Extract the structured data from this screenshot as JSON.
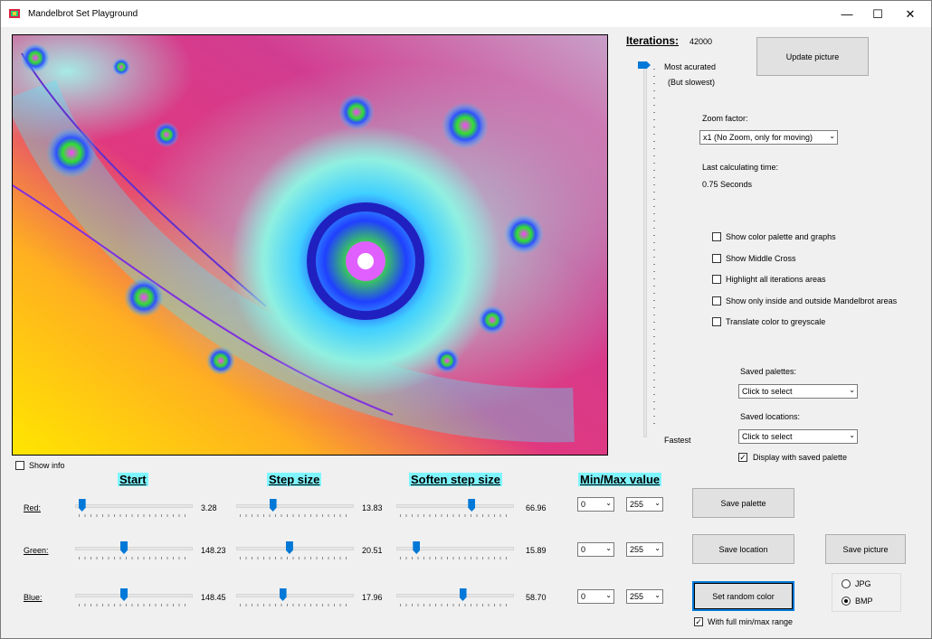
{
  "window": {
    "title": "Mandelbrot Set Playground",
    "minimize": "—",
    "maximize": "☐",
    "close": "✕"
  },
  "iterations": {
    "heading": "Iterations:",
    "value": "42000",
    "most": "Most acurated",
    "most_note": "(But slowest)",
    "fastest": "Fastest"
  },
  "update_button": "Update picture",
  "zoom": {
    "label": "Zoom factor:",
    "value": "x1 (No Zoom, only for moving)"
  },
  "calc_time": {
    "label": "Last calculating time:",
    "value": "0.75 Seconds"
  },
  "options": [
    {
      "label": "Show color palette and graphs",
      "checked": false
    },
    {
      "label": "Show Middle Cross",
      "checked": false
    },
    {
      "label": "Highlight all iterations areas",
      "checked": false
    },
    {
      "label": "Show only inside and outside Mandelbrot areas",
      "checked": false
    },
    {
      "label": "Translate color to greyscale",
      "checked": false
    }
  ],
  "saved_palettes": {
    "label": "Saved palettes:",
    "value": "Click to select"
  },
  "saved_locations": {
    "label": "Saved locations:",
    "value": "Click to select"
  },
  "display_saved_palette": {
    "label": "Display with saved palette",
    "checked": true
  },
  "show_info": {
    "label": "Show info",
    "checked": false
  },
  "columns": {
    "start": "Start",
    "step": "Step size",
    "soften": "Soften step size",
    "minmax": "Min/Max value"
  },
  "rows": [
    {
      "name": "Red:",
      "start": "3.28",
      "start_pos": 0.03,
      "step": "13.83",
      "step_pos": 0.3,
      "soften": "66.96",
      "soften_pos": 0.65,
      "min": "0",
      "max": "255"
    },
    {
      "name": "Green:",
      "start": "148.23",
      "start_pos": 0.41,
      "step": "20.51",
      "step_pos": 0.45,
      "soften": "15.89",
      "soften_pos": 0.15,
      "min": "0",
      "max": "255"
    },
    {
      "name": "Blue:",
      "start": "148.45",
      "start_pos": 0.41,
      "step": "17.96",
      "step_pos": 0.39,
      "soften": "58.70",
      "soften_pos": 0.57,
      "min": "0",
      "max": "255"
    }
  ],
  "buttons": {
    "save_palette": "Save  palette",
    "save_location": "Save location",
    "save_picture": "Save picture",
    "random_color": "Set random color"
  },
  "full_range": {
    "label": "With full min/max range",
    "checked": true
  },
  "format": {
    "jpg": "JPG",
    "bmp": "BMP",
    "selected": "BMP"
  }
}
